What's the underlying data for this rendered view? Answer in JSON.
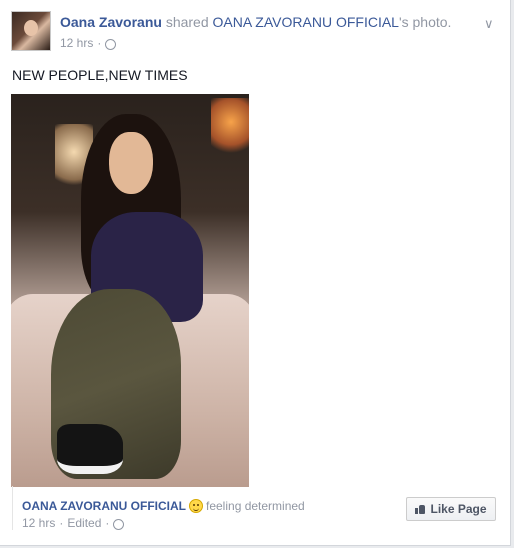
{
  "post": {
    "author": "Oana Zavoranu",
    "shared_text": "shared",
    "shared_target": "OANA ZAVORANU OFFICIAL",
    "shared_suffix": "'s photo.",
    "time": "12 hrs",
    "time_separator": "·",
    "text": "NEW PEOPLE,NEW TIMES",
    "options_icon": "chevron-down-icon",
    "privacy_icon": "globe-icon"
  },
  "shared_photo": {
    "page_name": "OANA ZAVORANU OFFICIAL",
    "feeling_icon": "smiley-emoji-icon",
    "feeling_text": "feeling determined",
    "time": "12 hrs",
    "edited_text": "Edited",
    "separator": "·",
    "privacy_icon": "globe-icon",
    "like_page_label": "Like Page",
    "like_icon": "thumbs-up-icon"
  },
  "colors": {
    "link": "#3b5998",
    "muted": "#9197a3",
    "text": "#141823"
  }
}
